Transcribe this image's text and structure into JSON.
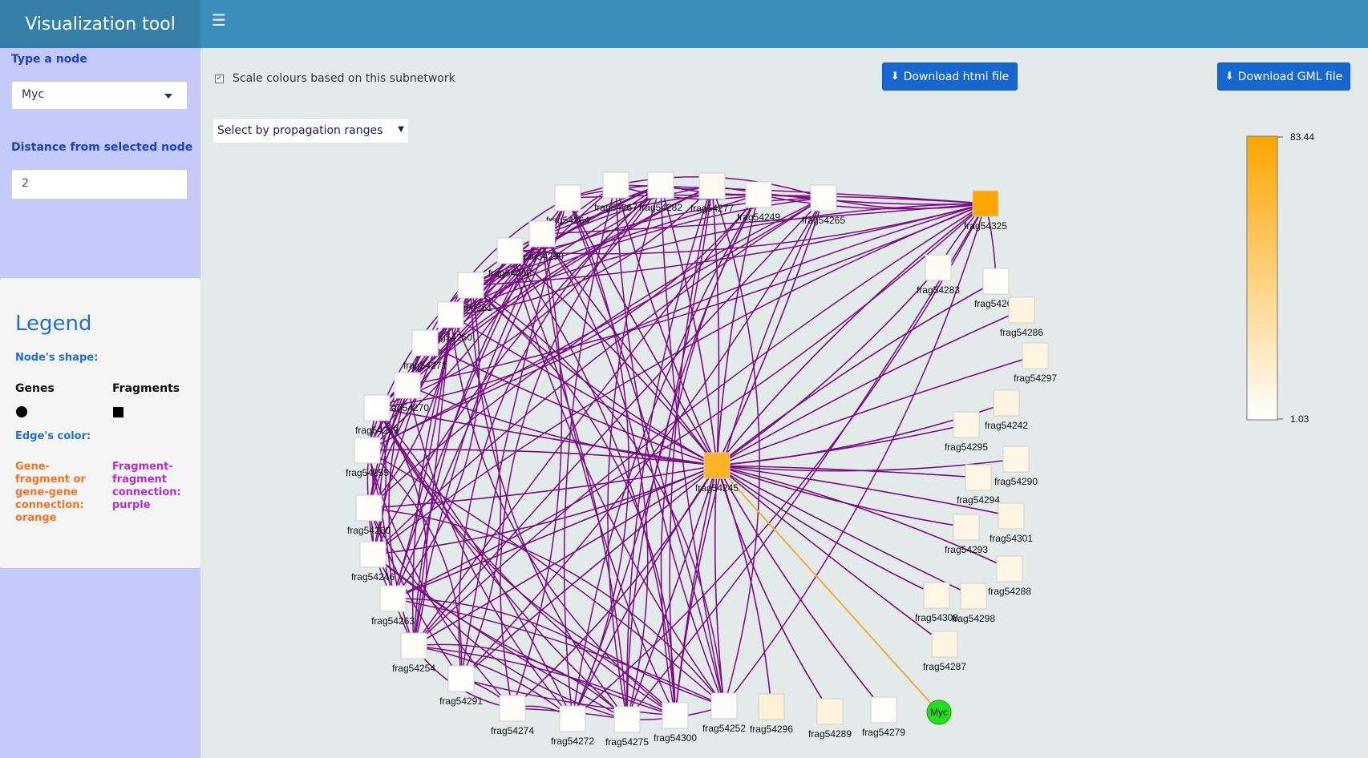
{
  "header": {
    "title": "Visualization tool"
  },
  "sidebar": {
    "node_label": "Type a node",
    "node_value": "Myc",
    "distance_label": "Distance from selected node",
    "distance_value": "2"
  },
  "legend": {
    "title": "Legend",
    "shape_header": "Node's shape:",
    "genes_label": "Genes",
    "fragments_label": "Fragments",
    "edge_header": "Edge's color:",
    "orange_text": "Gene-fragment or gene-gene connection: orange",
    "purple_text": "Fragment-fragment connection: purple"
  },
  "controls": {
    "scale_checkbox_label": "Scale colours based on this subnetwork",
    "scale_checked": true,
    "download_html_label": "Download html file",
    "download_gml_label": "Download GML file",
    "propagation_select": "Select by propagation ranges"
  },
  "colorbar": {
    "max": "83.44",
    "min": "1.03",
    "color_high": "#ffa500",
    "color_low": "#ffffff"
  },
  "colors": {
    "purple_edge": "#7b0a86",
    "orange_edge": "#f5a623",
    "gene_node": "#22e11a"
  },
  "network": {
    "nodes": [
      {
        "id": "frag54264",
        "v": 0.02
      },
      {
        "id": "frag54267",
        "v": 0.02
      },
      {
        "id": "frag54282",
        "v": 0.03
      },
      {
        "id": "frag54277",
        "v": 0.06
      },
      {
        "id": "frag54249",
        "v": 0.02
      },
      {
        "id": "frag54265",
        "v": 0.02
      },
      {
        "id": "frag54325",
        "v": 1.0
      },
      {
        "id": "frag54290",
        "v": 0.03
      },
      {
        "id": "frag54266",
        "v": 0.01
      },
      {
        "id": "frag54261",
        "v": 0.02
      },
      {
        "id": "frag54250",
        "v": 0.02
      },
      {
        "id": "frag54271",
        "v": 0.02
      },
      {
        "id": "frag54270",
        "v": 0.02
      },
      {
        "id": "frag54269",
        "v": 0.01
      },
      {
        "id": "frag54255",
        "v": 0.01
      },
      {
        "id": "frag54260",
        "v": 0.01
      },
      {
        "id": "frag54246",
        "v": 0.01
      },
      {
        "id": "frag54263",
        "v": 0.02
      },
      {
        "id": "frag54254",
        "v": 0.03
      },
      {
        "id": "frag54291",
        "v": 0.01
      },
      {
        "id": "frag54274",
        "v": 0.02
      },
      {
        "id": "frag54272",
        "v": 0.01
      },
      {
        "id": "frag54275",
        "v": 0.01
      },
      {
        "id": "frag54300",
        "v": 0.01
      },
      {
        "id": "frag54252",
        "v": 0.02
      },
      {
        "id": "frag54296",
        "v": 0.16
      },
      {
        "id": "frag54289",
        "v": 0.13
      },
      {
        "id": "frag54279",
        "v": 0.02
      },
      {
        "id": "frag54283",
        "v": 0.05
      },
      {
        "id": "frag54268",
        "v": 0.02
      },
      {
        "id": "frag54286",
        "v": 0.12
      },
      {
        "id": "frag54297",
        "v": 0.12
      },
      {
        "id": "frag54242",
        "v": 0.12
      },
      {
        "id": "frag54295",
        "v": 0.1
      },
      {
        "id": "frag54290b",
        "v": 0.1,
        "label": "frag54290"
      },
      {
        "id": "frag54294",
        "v": 0.1
      },
      {
        "id": "frag54301",
        "v": 0.12
      },
      {
        "id": "frag54293",
        "v": 0.1
      },
      {
        "id": "frag54288",
        "v": 0.1
      },
      {
        "id": "frag54308",
        "v": 0.1
      },
      {
        "id": "frag54298",
        "v": 0.1
      },
      {
        "id": "frag54287",
        "v": 0.12
      },
      {
        "id": "frag54245",
        "v": 0.85
      },
      {
        "id": "Myc",
        "v": 0,
        "gene": true
      }
    ]
  }
}
